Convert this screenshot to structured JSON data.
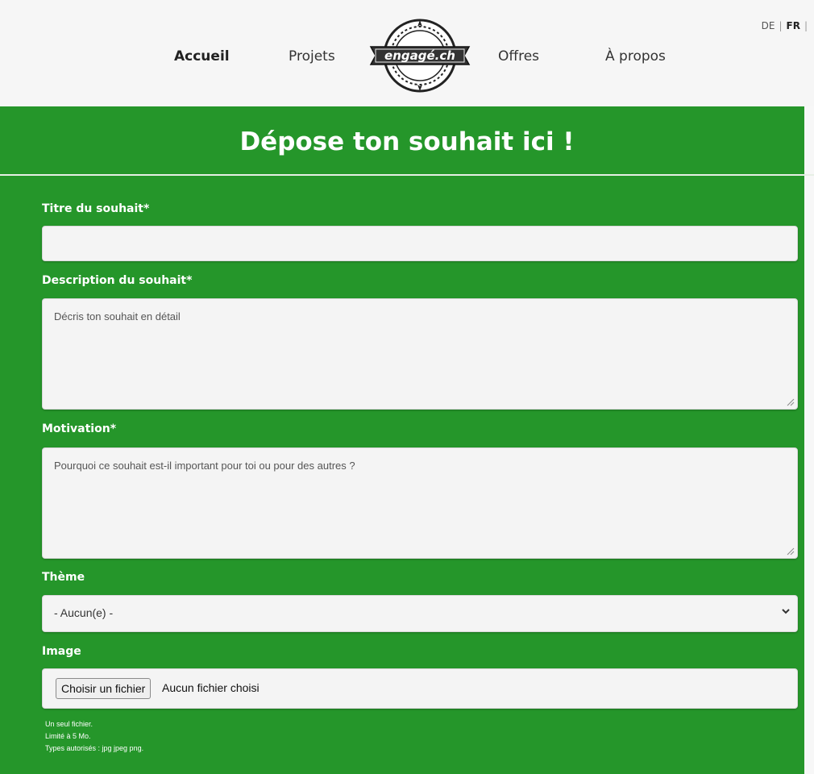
{
  "nav": {
    "items": [
      {
        "label": "Accueil",
        "active": true
      },
      {
        "label": "Projets",
        "active": false
      },
      {
        "label": "Offres",
        "active": false
      },
      {
        "label": "À propos",
        "active": false
      }
    ],
    "logo_text": "engagé.ch",
    "languages": {
      "de": "DE",
      "fr": "FR",
      "current": "FR"
    }
  },
  "page": {
    "title": "Dépose ton souhait ici !"
  },
  "form": {
    "title_label": "Titre du souhait*",
    "title_value": "",
    "description_label": "Description du souhait*",
    "description_placeholder": "Décris ton souhait en détail",
    "motivation_label": "Motivation*",
    "motivation_placeholder": "Pourquoi ce souhait est-il important pour toi ou pour des autres ?",
    "theme_label": "Thème",
    "theme_selected": "- Aucun(e) -",
    "image_label": "Image",
    "file_button": "Choisir un fichier",
    "file_status": "Aucun fichier choisi",
    "help": [
      "Un seul fichier.",
      "Limité à 5 Mo.",
      "Types autorisés : jpg jpeg png."
    ]
  },
  "colors": {
    "accent": "#25962a",
    "field_bg": "#f4f4f4"
  }
}
